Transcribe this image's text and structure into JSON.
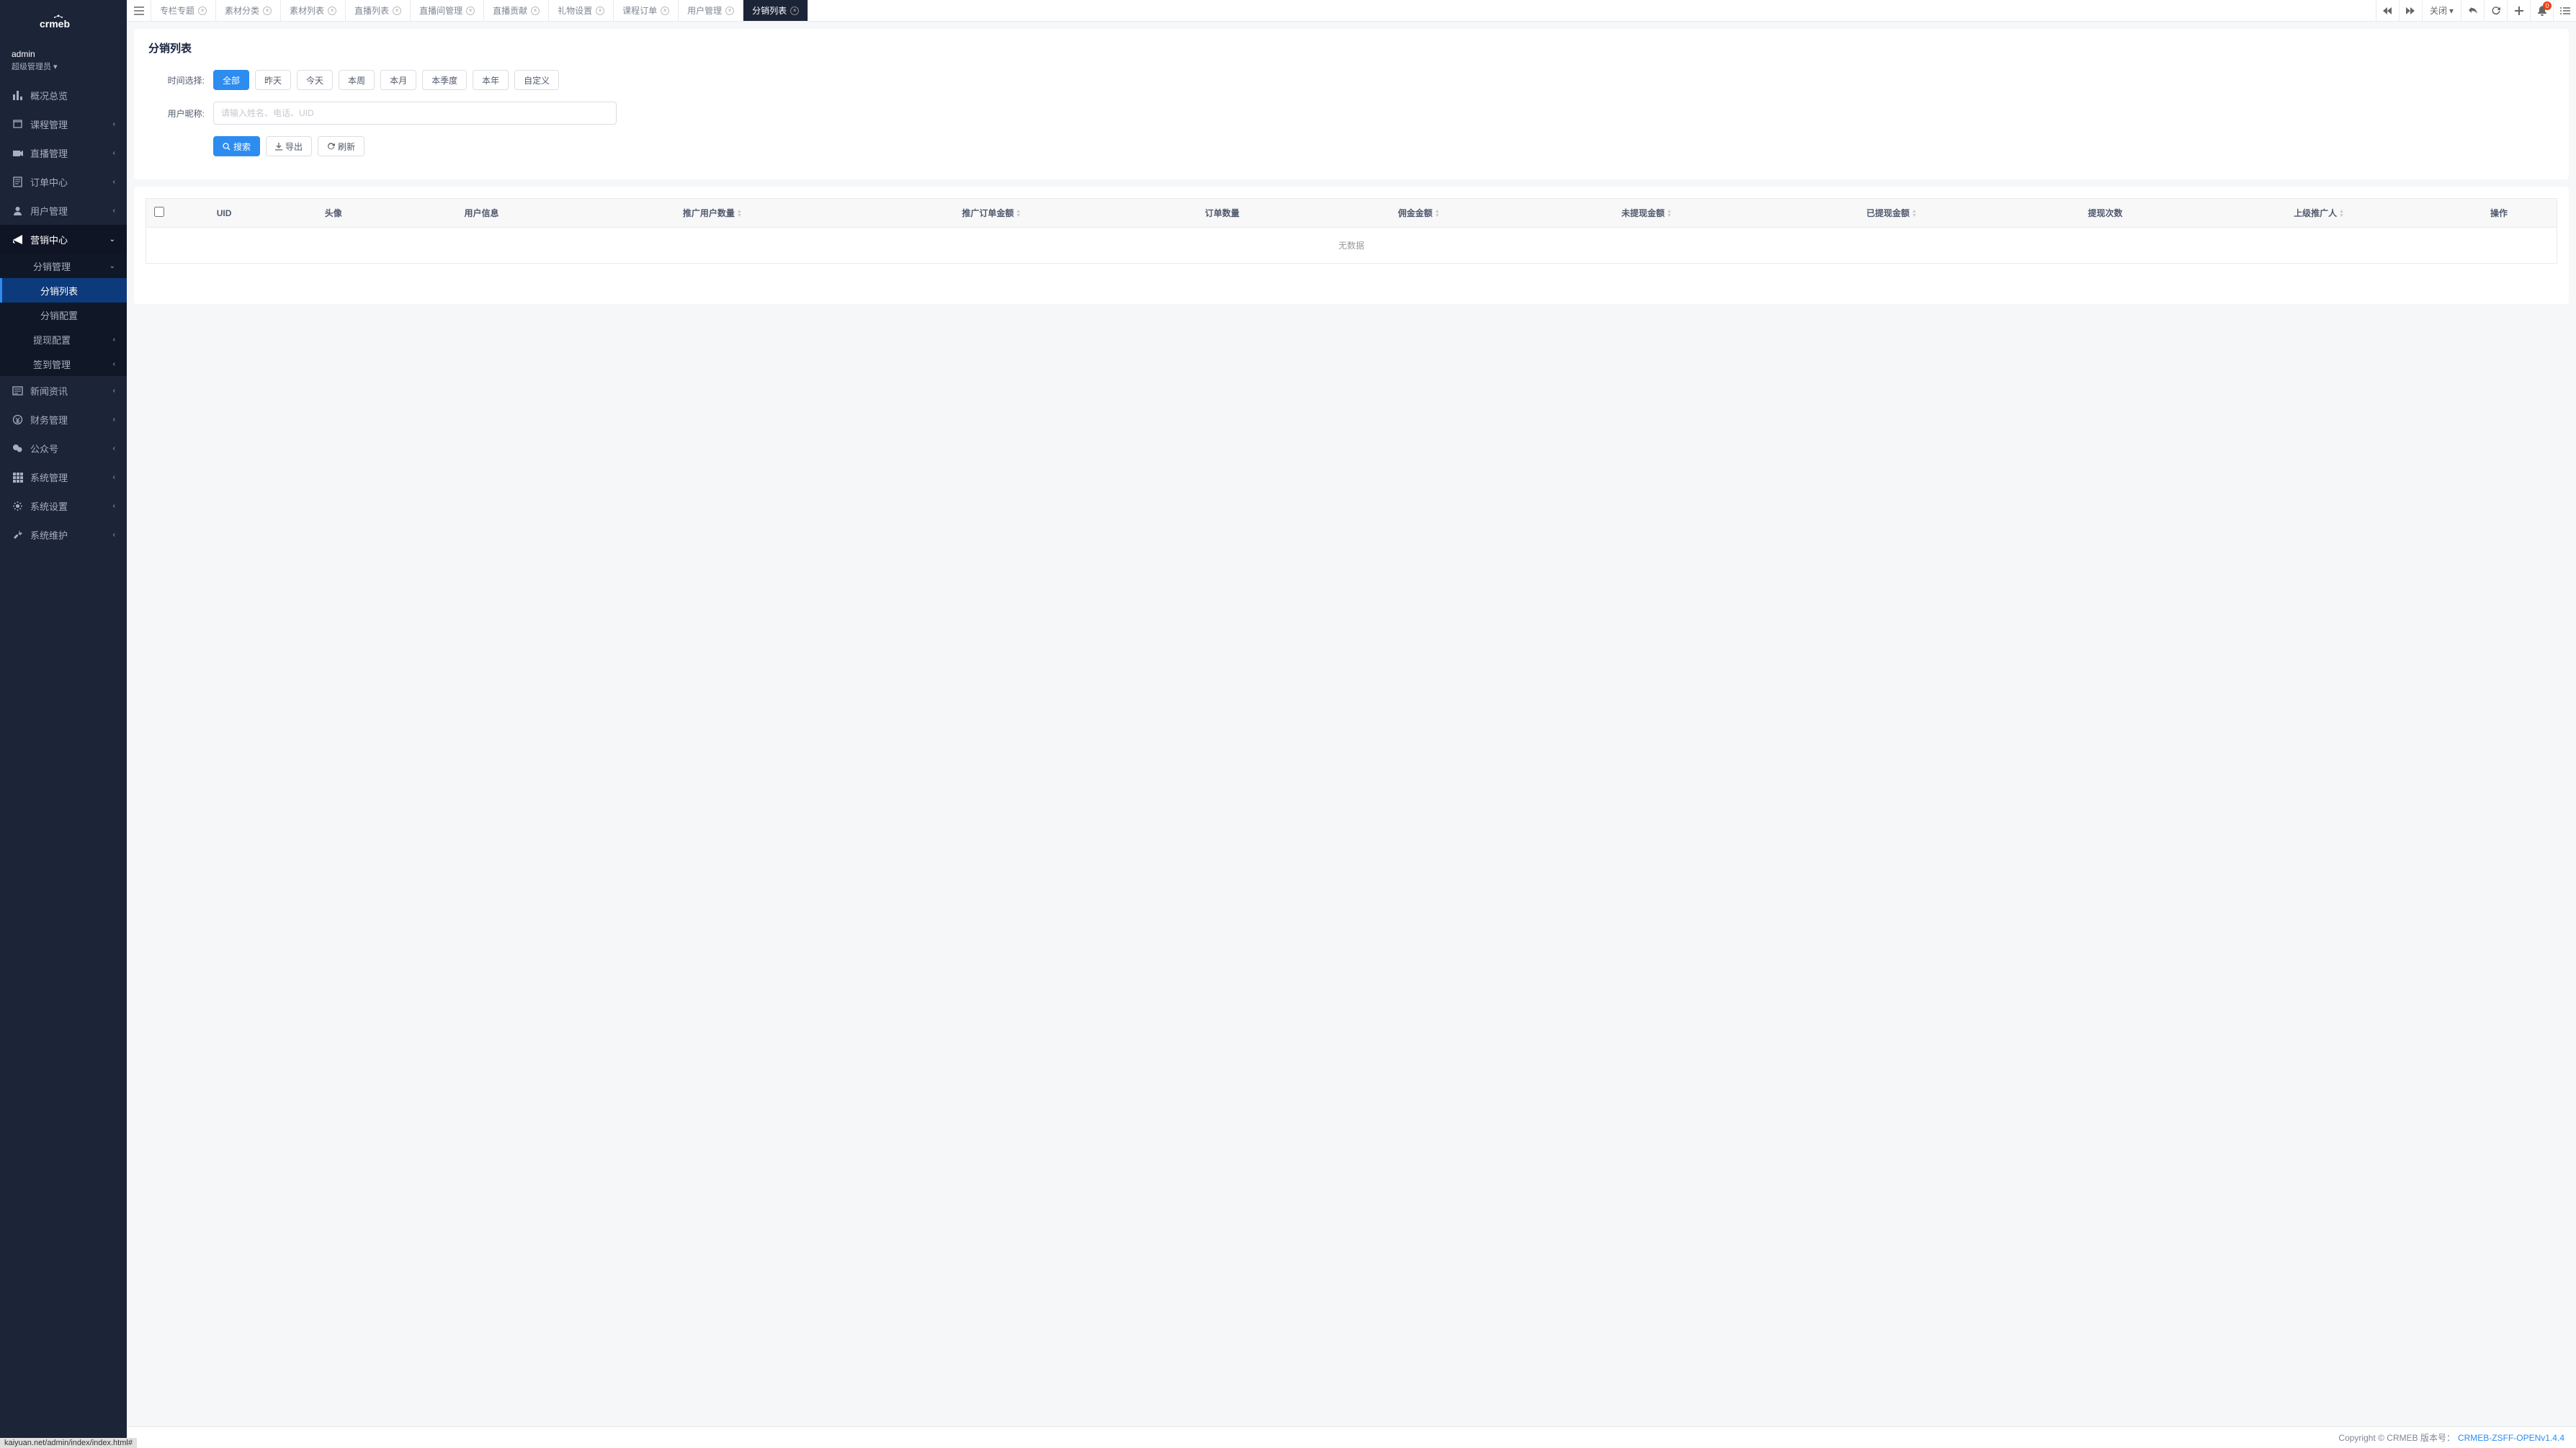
{
  "logo_text": "crmeb",
  "user": {
    "name": "admin",
    "role": "超级管理员"
  },
  "sidebar": [
    {
      "icon": "overview",
      "label": "概况总览",
      "expandable": false
    },
    {
      "icon": "course",
      "label": "课程管理",
      "expandable": true
    },
    {
      "icon": "live",
      "label": "直播管理",
      "expandable": true
    },
    {
      "icon": "order",
      "label": "订单中心",
      "expandable": true
    },
    {
      "icon": "users",
      "label": "用户管理",
      "expandable": true
    },
    {
      "icon": "marketing",
      "label": "营销中心",
      "expandable": true,
      "active": true,
      "open": true,
      "children": [
        {
          "label": "分销管理",
          "expandable": true,
          "open": true,
          "children": [
            {
              "label": "分销列表",
              "current": true
            },
            {
              "label": "分销配置"
            }
          ]
        },
        {
          "label": "提现配置",
          "expandable": true
        },
        {
          "label": "签到管理",
          "expandable": true
        }
      ]
    },
    {
      "icon": "news",
      "label": "新闻资讯",
      "expandable": true
    },
    {
      "icon": "finance",
      "label": "财务管理",
      "expandable": true
    },
    {
      "icon": "wechat",
      "label": "公众号",
      "expandable": true
    },
    {
      "icon": "system",
      "label": "系统管理",
      "expandable": true
    },
    {
      "icon": "settings",
      "label": "系统设置",
      "expandable": true
    },
    {
      "icon": "maintain",
      "label": "系统维护",
      "expandable": true
    }
  ],
  "tabs": [
    {
      "label": "专栏专题"
    },
    {
      "label": "素材分类"
    },
    {
      "label": "素材列表"
    },
    {
      "label": "直播列表"
    },
    {
      "label": "直播间管理"
    },
    {
      "label": "直播贡献"
    },
    {
      "label": "礼物设置"
    },
    {
      "label": "课程订单"
    },
    {
      "label": "用户管理"
    },
    {
      "label": "分销列表",
      "active": true
    }
  ],
  "top_actions": {
    "close_label": "关闭",
    "notification_count": "0"
  },
  "page": {
    "title": "分销列表",
    "time_label": "时间选择:",
    "time_buttons": [
      "全部",
      "昨天",
      "今天",
      "本周",
      "本月",
      "本季度",
      "本年",
      "自定义"
    ],
    "nickname_label": "用户昵称:",
    "nickname_placeholder": "请输入姓名、电话、UID",
    "search_btn": "搜索",
    "export_btn": "导出",
    "refresh_btn": "刷新",
    "columns": [
      "UID",
      "头像",
      "用户信息",
      "推广用户数量",
      "推广订单金额",
      "订单数量",
      "佣金金额",
      "未提现金额",
      "已提现金额",
      "提现次数",
      "上级推广人",
      "操作"
    ],
    "sortable_cols": [
      3,
      4,
      6,
      7,
      8,
      10
    ],
    "empty_text": "无数据"
  },
  "footer": {
    "copyright": "Copyright © CRMEB 版本号：",
    "version": "CRMEB-ZSFF-OPENv1.4.4"
  },
  "status_url": "kaiyuan.net/admin/index/index.html#"
}
